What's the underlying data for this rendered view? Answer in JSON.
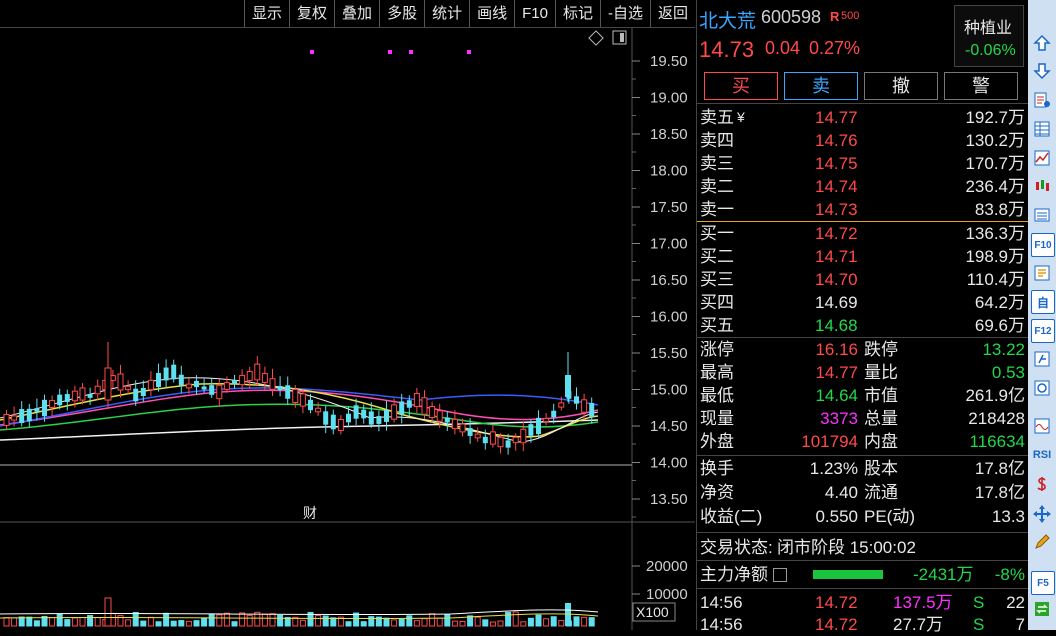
{
  "toolbar": {
    "items": [
      "显示",
      "复权",
      "叠加",
      "多股",
      "统计",
      "画线",
      "F10",
      "标记",
      "-自选",
      "返回"
    ]
  },
  "chart": {
    "price_axis": [
      "19.50",
      "19.00",
      "18.50",
      "18.00",
      "17.50",
      "17.00",
      "16.50",
      "16.00",
      "15.50",
      "15.00",
      "14.50",
      "14.00",
      "13.50"
    ],
    "volume_axis": [
      "20000",
      "10000"
    ],
    "volume_unit": "X100",
    "finance_marker": "财"
  },
  "quote": {
    "name": "北大荒",
    "code": "600598",
    "badge": "R",
    "index_tag": "500",
    "price": "14.73",
    "change": "0.04",
    "change_pct": "0.27%",
    "industry": "种植业",
    "industry_change": "-0.06%"
  },
  "trade_buttons": {
    "buy": "买",
    "sell": "卖",
    "cancel": "撤",
    "alert": "警"
  },
  "sell_levels": [
    {
      "label": "卖五",
      "price": "14.77",
      "vol": "192.7万"
    },
    {
      "label": "卖四",
      "price": "14.76",
      "vol": "130.2万"
    },
    {
      "label": "卖三",
      "price": "14.75",
      "vol": "170.7万"
    },
    {
      "label": "卖二",
      "price": "14.74",
      "vol": "236.4万"
    },
    {
      "label": "卖一",
      "price": "14.73",
      "vol": "83.8万"
    }
  ],
  "yuan_sign": "¥",
  "buy_levels": [
    {
      "label": "买一",
      "price": "14.72",
      "vol": "136.3万"
    },
    {
      "label": "买二",
      "price": "14.71",
      "vol": "198.9万"
    },
    {
      "label": "买三",
      "price": "14.70",
      "vol": "110.4万"
    },
    {
      "label": "买四",
      "price": "14.69",
      "vol": "64.2万"
    },
    {
      "label": "买五",
      "price": "14.68",
      "vol": "69.6万"
    }
  ],
  "stats": [
    {
      "l1": "涨停",
      "v1": "16.16",
      "l2": "跌停",
      "v2": "13.22"
    },
    {
      "l1": "最高",
      "v1": "14.77",
      "l2": "量比",
      "v2": "0.53"
    },
    {
      "l1": "最低",
      "v1": "14.64",
      "l2": "市值",
      "v2": "261.9亿"
    },
    {
      "l1": "现量",
      "v1": "3373",
      "l2": "总量",
      "v2": "218428"
    },
    {
      "l1": "外盘",
      "v1": "101794",
      "l2": "内盘",
      "v2": "116634"
    }
  ],
  "finance": [
    {
      "l1": "换手",
      "v1": "1.23%",
      "l2": "股本",
      "v2": "17.8亿"
    },
    {
      "l1": "净资",
      "v1": "4.40",
      "l2": "流通",
      "v2": "17.8亿"
    },
    {
      "l1": "收益(二)",
      "v1": "0.550",
      "l2": "PE(动)",
      "v2": "13.3"
    }
  ],
  "status": {
    "label": "交易状态:",
    "value": "闭市阶段 15:00:02"
  },
  "capital": {
    "label": "主力净额",
    "value": "-2431万",
    "pct": "-8%"
  },
  "ticks": [
    {
      "time": "14:56",
      "price": "14.72",
      "vol": "137.5万",
      "side": "S",
      "count": "22"
    },
    {
      "time": "14:56",
      "price": "14.72",
      "vol": "27.7万",
      "side": "S",
      "count": "7"
    }
  ],
  "icons": [
    "arrow-up-icon",
    "arrow-down-icon",
    "report-icon",
    "quote-grid-icon",
    "trend-chart-icon",
    "candle-chart-icon",
    "list-icon",
    "f10-icon",
    "news-icon",
    "self-select-icon",
    "f12-icon",
    "formula-icon",
    "refresh-icon",
    "wave-chart-icon",
    "rsi-icon",
    "dollar-icon",
    "move-icon",
    "pencil-icon",
    "f5-icon",
    "switch-icon"
  ],
  "icon_labels": {
    "f10": "F10",
    "self": "自",
    "f12": "F12",
    "rsi": "RSI",
    "f5": "F5"
  },
  "colors": {
    "up": "#ff4a4a",
    "down": "#22d84a",
    "volume_now": "#ff30ff",
    "accent": "#0066cc"
  }
}
